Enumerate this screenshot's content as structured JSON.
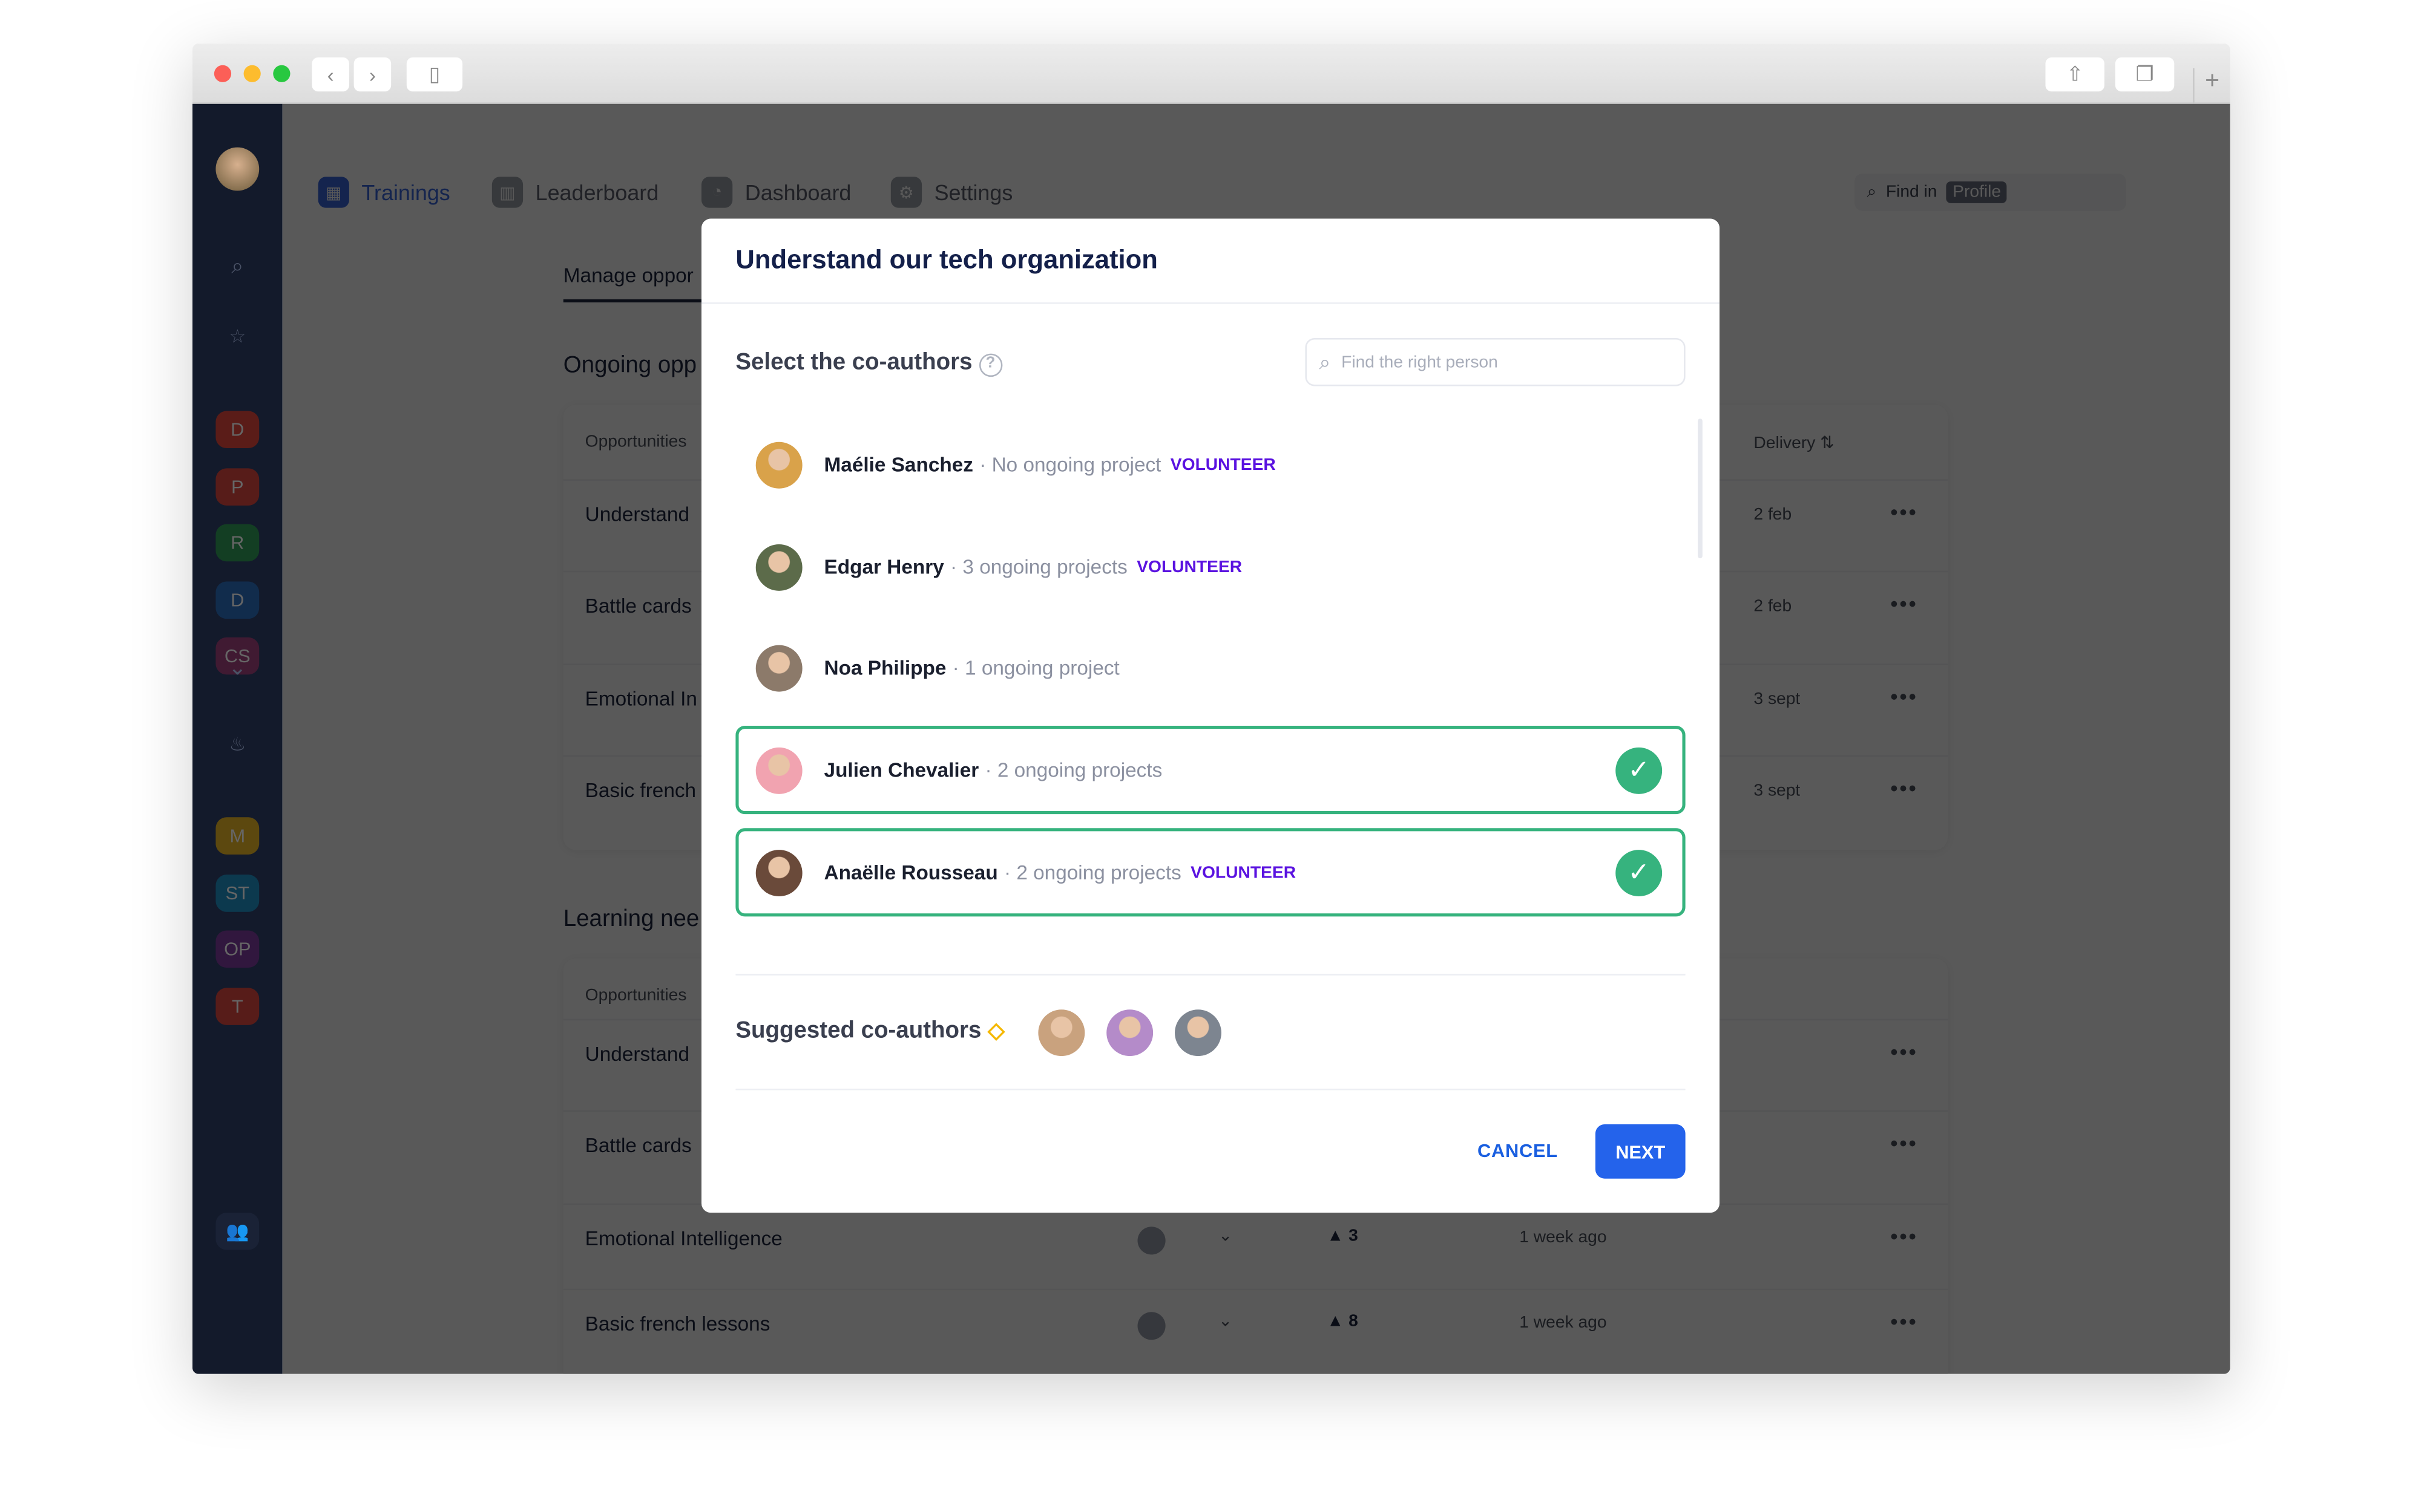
{
  "nav": {
    "tabs": [
      {
        "label": "Trainings",
        "active": true
      },
      {
        "label": "Leaderboard"
      },
      {
        "label": "Dashboard"
      },
      {
        "label": "Settings"
      }
    ],
    "find_label": "Find in",
    "find_scope": "Profile"
  },
  "sidebar": {
    "badges_top": [
      {
        "label": "D",
        "color": "#e0463c"
      },
      {
        "label": "P",
        "color": "#d9473e"
      },
      {
        "label": "R",
        "color": "#2f9a57"
      },
      {
        "label": "D",
        "color": "#2b6fbf"
      },
      {
        "label": "CS",
        "color": "#a0407c"
      }
    ],
    "badges_bottom": [
      {
        "label": "M",
        "color": "#e6b325"
      },
      {
        "label": "ST",
        "color": "#1f8fc4"
      },
      {
        "label": "OP",
        "color": "#7a3a9a"
      },
      {
        "label": "T",
        "color": "#d9473e"
      }
    ]
  },
  "page": {
    "tab": "Manage oppor",
    "ongoing": {
      "title": "Ongoing opp",
      "col_opportunities": "Opportunities",
      "col_delivery": "Delivery",
      "rows": [
        {
          "title": "Understand",
          "delivery": "2 feb"
        },
        {
          "title": "Battle cards",
          "delivery": "2 feb"
        },
        {
          "title": "Emotional In",
          "delivery": "3 sept"
        },
        {
          "title": "Basic french",
          "delivery": "3 sept"
        }
      ]
    },
    "learning": {
      "title": "Learning nee",
      "col_opportunities": "Opportunities",
      "rows": [
        {
          "title": "Understand"
        },
        {
          "title": "Battle cards"
        },
        {
          "title": "Emotional Intelligence",
          "votes": "3",
          "time": "1 week ago"
        },
        {
          "title": "Basic french lessons",
          "votes": "8",
          "time": "1 week ago"
        }
      ]
    }
  },
  "modal": {
    "title": "Understand our tech organization",
    "select_label": "Select the co-authors",
    "search_placeholder": "Find the right person",
    "people": [
      {
        "name": "Maélie Sanchez",
        "meta": "· No ongoing project",
        "volunteer": "VOLUNTEER",
        "selected": false,
        "color": "#d9a24a"
      },
      {
        "name": "Edgar Henry",
        "meta": "· 3 ongoing projects",
        "volunteer": "VOLUNTEER",
        "selected": false,
        "color": "#5c6b4a"
      },
      {
        "name": "Noa Philippe",
        "meta": "· 1 ongoing project",
        "volunteer": "",
        "selected": false,
        "color": "#8c7a6a"
      },
      {
        "name": "Julien Chevalier",
        "meta": "· 2 ongoing projects",
        "volunteer": "",
        "selected": true,
        "color": "#f1a3b0"
      },
      {
        "name": "Anaëlle Rousseau",
        "meta": "· 2 ongoing projects",
        "volunteer": "VOLUNTEER",
        "selected": true,
        "color": "#6a4a3a"
      }
    ],
    "suggested_label": "Suggested co-authors",
    "suggested_colors": [
      "#c9a27e",
      "#b48bc9",
      "#7d8590"
    ],
    "cancel": "CANCEL",
    "next": "NEXT"
  },
  "colors": {
    "accent": "#2463eb",
    "selected": "#36b37e",
    "volunteer": "#5a12e0"
  }
}
